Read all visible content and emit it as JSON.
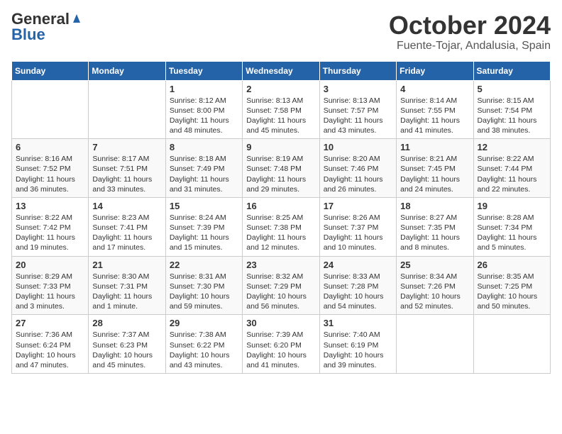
{
  "header": {
    "logo_general": "General",
    "logo_blue": "Blue",
    "month_title": "October 2024",
    "location": "Fuente-Tojar, Andalusia, Spain"
  },
  "weekdays": [
    "Sunday",
    "Monday",
    "Tuesday",
    "Wednesday",
    "Thursday",
    "Friday",
    "Saturday"
  ],
  "weeks": [
    [
      {
        "day": "",
        "content": ""
      },
      {
        "day": "",
        "content": ""
      },
      {
        "day": "1",
        "content": "Sunrise: 8:12 AM\nSunset: 8:00 PM\nDaylight: 11 hours and 48 minutes."
      },
      {
        "day": "2",
        "content": "Sunrise: 8:13 AM\nSunset: 7:58 PM\nDaylight: 11 hours and 45 minutes."
      },
      {
        "day": "3",
        "content": "Sunrise: 8:13 AM\nSunset: 7:57 PM\nDaylight: 11 hours and 43 minutes."
      },
      {
        "day": "4",
        "content": "Sunrise: 8:14 AM\nSunset: 7:55 PM\nDaylight: 11 hours and 41 minutes."
      },
      {
        "day": "5",
        "content": "Sunrise: 8:15 AM\nSunset: 7:54 PM\nDaylight: 11 hours and 38 minutes."
      }
    ],
    [
      {
        "day": "6",
        "content": "Sunrise: 8:16 AM\nSunset: 7:52 PM\nDaylight: 11 hours and 36 minutes."
      },
      {
        "day": "7",
        "content": "Sunrise: 8:17 AM\nSunset: 7:51 PM\nDaylight: 11 hours and 33 minutes."
      },
      {
        "day": "8",
        "content": "Sunrise: 8:18 AM\nSunset: 7:49 PM\nDaylight: 11 hours and 31 minutes."
      },
      {
        "day": "9",
        "content": "Sunrise: 8:19 AM\nSunset: 7:48 PM\nDaylight: 11 hours and 29 minutes."
      },
      {
        "day": "10",
        "content": "Sunrise: 8:20 AM\nSunset: 7:46 PM\nDaylight: 11 hours and 26 minutes."
      },
      {
        "day": "11",
        "content": "Sunrise: 8:21 AM\nSunset: 7:45 PM\nDaylight: 11 hours and 24 minutes."
      },
      {
        "day": "12",
        "content": "Sunrise: 8:22 AM\nSunset: 7:44 PM\nDaylight: 11 hours and 22 minutes."
      }
    ],
    [
      {
        "day": "13",
        "content": "Sunrise: 8:22 AM\nSunset: 7:42 PM\nDaylight: 11 hours and 19 minutes."
      },
      {
        "day": "14",
        "content": "Sunrise: 8:23 AM\nSunset: 7:41 PM\nDaylight: 11 hours and 17 minutes."
      },
      {
        "day": "15",
        "content": "Sunrise: 8:24 AM\nSunset: 7:39 PM\nDaylight: 11 hours and 15 minutes."
      },
      {
        "day": "16",
        "content": "Sunrise: 8:25 AM\nSunset: 7:38 PM\nDaylight: 11 hours and 12 minutes."
      },
      {
        "day": "17",
        "content": "Sunrise: 8:26 AM\nSunset: 7:37 PM\nDaylight: 11 hours and 10 minutes."
      },
      {
        "day": "18",
        "content": "Sunrise: 8:27 AM\nSunset: 7:35 PM\nDaylight: 11 hours and 8 minutes."
      },
      {
        "day": "19",
        "content": "Sunrise: 8:28 AM\nSunset: 7:34 PM\nDaylight: 11 hours and 5 minutes."
      }
    ],
    [
      {
        "day": "20",
        "content": "Sunrise: 8:29 AM\nSunset: 7:33 PM\nDaylight: 11 hours and 3 minutes."
      },
      {
        "day": "21",
        "content": "Sunrise: 8:30 AM\nSunset: 7:31 PM\nDaylight: 11 hours and 1 minute."
      },
      {
        "day": "22",
        "content": "Sunrise: 8:31 AM\nSunset: 7:30 PM\nDaylight: 10 hours and 59 minutes."
      },
      {
        "day": "23",
        "content": "Sunrise: 8:32 AM\nSunset: 7:29 PM\nDaylight: 10 hours and 56 minutes."
      },
      {
        "day": "24",
        "content": "Sunrise: 8:33 AM\nSunset: 7:28 PM\nDaylight: 10 hours and 54 minutes."
      },
      {
        "day": "25",
        "content": "Sunrise: 8:34 AM\nSunset: 7:26 PM\nDaylight: 10 hours and 52 minutes."
      },
      {
        "day": "26",
        "content": "Sunrise: 8:35 AM\nSunset: 7:25 PM\nDaylight: 10 hours and 50 minutes."
      }
    ],
    [
      {
        "day": "27",
        "content": "Sunrise: 7:36 AM\nSunset: 6:24 PM\nDaylight: 10 hours and 47 minutes."
      },
      {
        "day": "28",
        "content": "Sunrise: 7:37 AM\nSunset: 6:23 PM\nDaylight: 10 hours and 45 minutes."
      },
      {
        "day": "29",
        "content": "Sunrise: 7:38 AM\nSunset: 6:22 PM\nDaylight: 10 hours and 43 minutes."
      },
      {
        "day": "30",
        "content": "Sunrise: 7:39 AM\nSunset: 6:20 PM\nDaylight: 10 hours and 41 minutes."
      },
      {
        "day": "31",
        "content": "Sunrise: 7:40 AM\nSunset: 6:19 PM\nDaylight: 10 hours and 39 minutes."
      },
      {
        "day": "",
        "content": ""
      },
      {
        "day": "",
        "content": ""
      }
    ]
  ]
}
